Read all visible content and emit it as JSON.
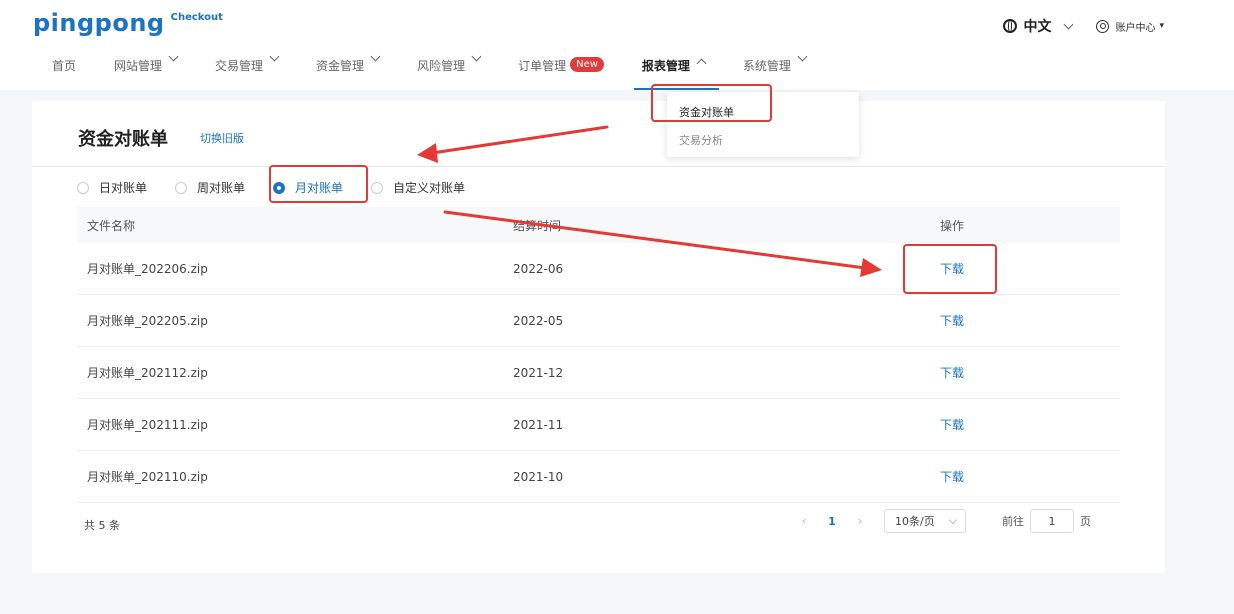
{
  "header": {
    "logo": "pingpong",
    "logo_sub": "Checkout",
    "language": "中文",
    "account": "账户中心"
  },
  "nav": {
    "items": [
      {
        "label": "首页"
      },
      {
        "label": "网站管理"
      },
      {
        "label": "交易管理"
      },
      {
        "label": "资金管理"
      },
      {
        "label": "风险管理"
      },
      {
        "label": "订单管理",
        "badge": "New"
      },
      {
        "label": "报表管理"
      },
      {
        "label": "系统管理"
      }
    ]
  },
  "dropdown": {
    "items": [
      "资金对账单",
      "交易分析"
    ]
  },
  "page": {
    "title": "资金对账单",
    "switch_link": "切换旧版"
  },
  "filters": {
    "options": [
      "日对账单",
      "周对账单",
      "月对账单",
      "自定义对账单"
    ],
    "selected": "月对账单"
  },
  "table": {
    "headers": [
      "文件名称",
      "结算时间",
      "操作"
    ],
    "rows": [
      {
        "file": "月对账单_202206.zip",
        "period": "2022-06",
        "action": "下载"
      },
      {
        "file": "月对账单_202205.zip",
        "period": "2022-05",
        "action": "下载"
      },
      {
        "file": "月对账单_202112.zip",
        "period": "2021-12",
        "action": "下载"
      },
      {
        "file": "月对账单_202111.zip",
        "period": "2021-11",
        "action": "下载"
      },
      {
        "file": "月对账单_202110.zip",
        "period": "2021-10",
        "action": "下载"
      }
    ]
  },
  "pagination": {
    "total": "共 5 条",
    "current_page": "1",
    "page_size": "10条/页",
    "goto_label": "前往",
    "goto_value": "1",
    "page_unit": "页"
  },
  "annotation_color": "#e53935"
}
